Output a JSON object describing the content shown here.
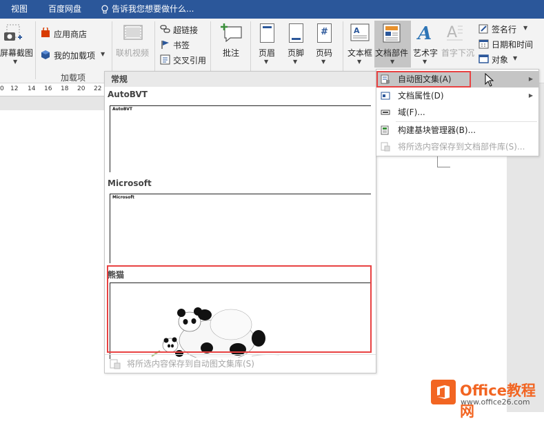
{
  "tabs": [
    "视图",
    "百度网盘"
  ],
  "tell_me": "告诉我您想要做什么...",
  "ribbon": {
    "screenshot": "屏幕截图",
    "app_store": "应用商店",
    "my_addins": "我的加载项",
    "addins_group": "加载项",
    "online_video": "联机视频",
    "hyperlink": "超链接",
    "bookmark": "书签",
    "cross_ref": "交叉引用",
    "comment": "批注",
    "header": "页眉",
    "footer": "页脚",
    "page_number": "页码",
    "page_number_icon": "#",
    "text_box": "文本框",
    "quick_parts": "文档部件",
    "wordart": "艺术字",
    "drop_cap": "首字下沉",
    "signature_line": "签名行",
    "date_time": "日期和时间",
    "object": "对象"
  },
  "ruler": [
    "0",
    "12",
    "14",
    "16",
    "18",
    "20",
    "22"
  ],
  "gallery": {
    "section": "常规",
    "entries": [
      {
        "title": "AutoBVT",
        "preview_text": "AutoBVT"
      },
      {
        "title": "Microsoft",
        "preview_text": "Microsoft"
      },
      {
        "title": "熊猫",
        "preview_text": ""
      }
    ],
    "footer": "将所选内容保存到自动图文集库(S)"
  },
  "menu": {
    "items": [
      {
        "label": "自动图文集(A)",
        "submenu": true
      },
      {
        "label": "文档属性(D)",
        "submenu": true
      },
      {
        "label": "域(F)...",
        "submenu": false
      },
      {
        "label": "构建基块管理器(B)...",
        "submenu": false
      },
      {
        "label": "将所选内容保存到文档部件库(S)...",
        "submenu": false
      }
    ]
  },
  "watermark": {
    "brand": "Office教程网",
    "url": "www.office26.com"
  },
  "colors": {
    "accent": "#2b579a",
    "highlight_box": "#e84141",
    "ribbon_bg": "#f3f3f3",
    "watermark_orange": "#f26522"
  }
}
